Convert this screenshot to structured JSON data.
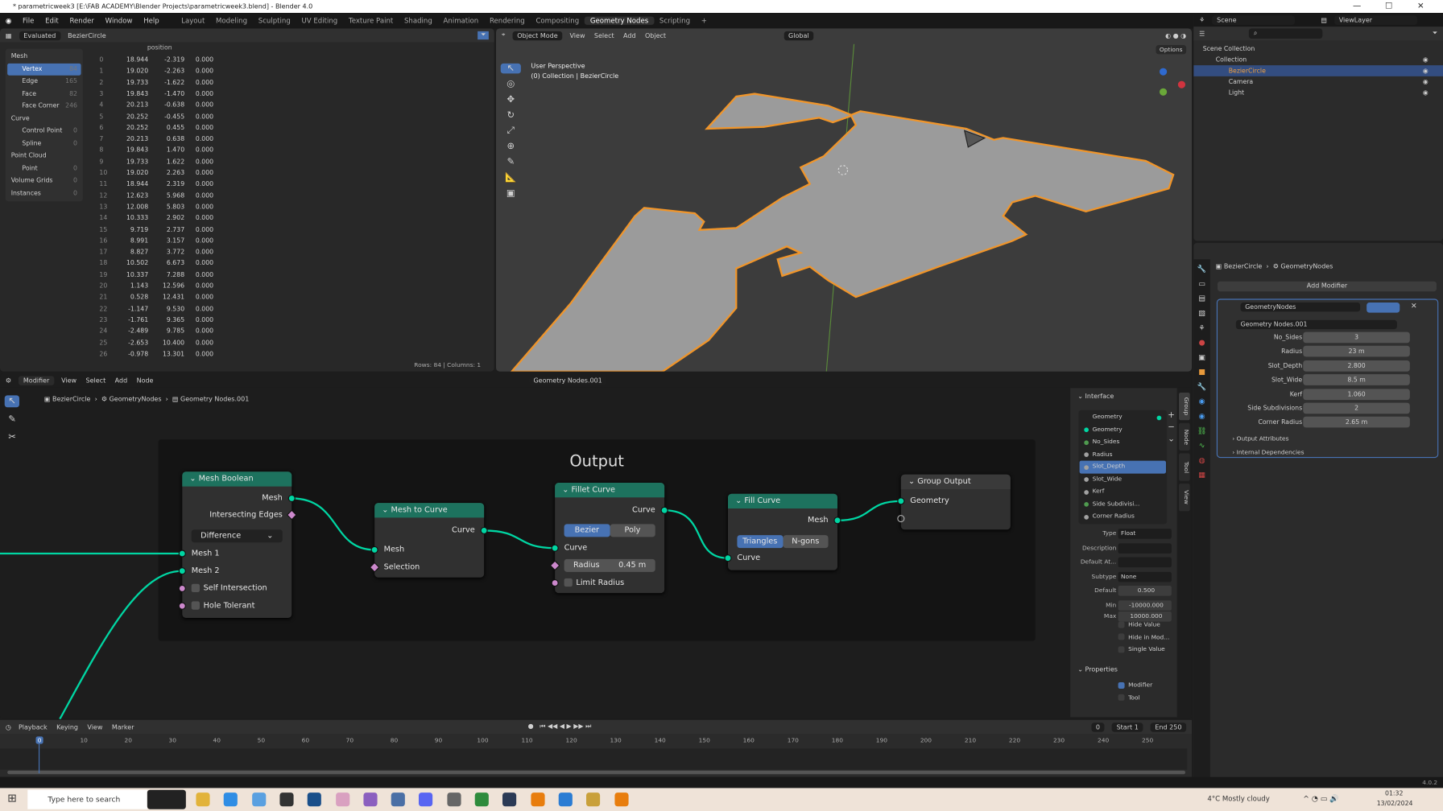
{
  "window": {
    "title": "* parametricweek3 [E:\\FAB ACADEMY\\Blender Projects\\parametricweek3.blend] - Blender 4.0",
    "minimize": "—",
    "maximize": "☐",
    "close": "✕"
  },
  "menu": [
    "File",
    "Edit",
    "Render",
    "Window",
    "Help"
  ],
  "workspaces": [
    "Layout",
    "Modeling",
    "Sculpting",
    "UV Editing",
    "Texture Paint",
    "Shading",
    "Animation",
    "Rendering",
    "Compositing",
    "Geometry Nodes",
    "Scripting",
    "+"
  ],
  "active_workspace": "Geometry Nodes",
  "spreadsheet": {
    "mode": "Evaluated",
    "object": "BezierCircle",
    "column": "position",
    "domains": [
      {
        "label": "Mesh",
        "count": "",
        "level": 0
      },
      {
        "label": "Vertex",
        "count": "84",
        "level": 1,
        "selected": true
      },
      {
        "label": "Edge",
        "count": "165",
        "level": 1
      },
      {
        "label": "Face",
        "count": "82",
        "level": 1
      },
      {
        "label": "Face Corner",
        "count": "246",
        "level": 1
      },
      {
        "label": "Curve",
        "count": "",
        "level": 0
      },
      {
        "label": "Control Point",
        "count": "0",
        "level": 1
      },
      {
        "label": "Spline",
        "count": "0",
        "level": 1
      },
      {
        "label": "Point Cloud",
        "count": "",
        "level": 0
      },
      {
        "label": "Point",
        "count": "0",
        "level": 1
      },
      {
        "label": "Volume Grids",
        "count": "0",
        "level": 0
      },
      {
        "label": "Instances",
        "count": "0",
        "level": 0
      }
    ],
    "rows": [
      [
        "0",
        "18.944",
        "-2.319",
        "0.000"
      ],
      [
        "1",
        "19.020",
        "-2.263",
        "0.000"
      ],
      [
        "2",
        "19.733",
        "-1.622",
        "0.000"
      ],
      [
        "3",
        "19.843",
        "-1.470",
        "0.000"
      ],
      [
        "4",
        "20.213",
        "-0.638",
        "0.000"
      ],
      [
        "5",
        "20.252",
        "-0.455",
        "0.000"
      ],
      [
        "6",
        "20.252",
        "0.455",
        "0.000"
      ],
      [
        "7",
        "20.213",
        "0.638",
        "0.000"
      ],
      [
        "8",
        "19.843",
        "1.470",
        "0.000"
      ],
      [
        "9",
        "19.733",
        "1.622",
        "0.000"
      ],
      [
        "10",
        "19.020",
        "2.263",
        "0.000"
      ],
      [
        "11",
        "18.944",
        "2.319",
        "0.000"
      ],
      [
        "12",
        "12.623",
        "5.968",
        "0.000"
      ],
      [
        "13",
        "12.008",
        "5.803",
        "0.000"
      ],
      [
        "14",
        "10.333",
        "2.902",
        "0.000"
      ],
      [
        "15",
        "9.719",
        "2.737",
        "0.000"
      ],
      [
        "16",
        "8.991",
        "3.157",
        "0.000"
      ],
      [
        "17",
        "8.827",
        "3.772",
        "0.000"
      ],
      [
        "18",
        "10.502",
        "6.673",
        "0.000"
      ],
      [
        "19",
        "10.337",
        "7.288",
        "0.000"
      ],
      [
        "20",
        "1.143",
        "12.596",
        "0.000"
      ],
      [
        "21",
        "0.528",
        "12.431",
        "0.000"
      ],
      [
        "22",
        "-1.147",
        "9.530",
        "0.000"
      ],
      [
        "23",
        "-1.761",
        "9.365",
        "0.000"
      ],
      [
        "24",
        "-2.489",
        "9.785",
        "0.000"
      ],
      [
        "25",
        "-2.653",
        "10.400",
        "0.000"
      ],
      [
        "26",
        "-0.978",
        "13.301",
        "0.000"
      ]
    ],
    "footer": "Rows: 84  |  Columns: 1"
  },
  "viewport": {
    "mode": "Object Mode",
    "menus": [
      "View",
      "Select",
      "Add",
      "Object"
    ],
    "orientation": "Global",
    "options": "Options",
    "title": "User Perspective",
    "subtitle": "(0) Collection | BezierCircle",
    "shape_fill": "#9b9b9b",
    "outline": "#f0952a"
  },
  "outliner": {
    "scene": "Scene",
    "view_layer": "ViewLayer",
    "items": [
      {
        "label": "Scene Collection",
        "level": 0
      },
      {
        "label": "Collection",
        "level": 1
      },
      {
        "label": "BezierCircle",
        "level": 2,
        "selected": true
      },
      {
        "label": "Camera",
        "level": 2
      },
      {
        "label": "Light",
        "level": 2
      }
    ]
  },
  "properties": {
    "breadcrumb": [
      "BezierCircle",
      "GeometryNodes"
    ],
    "add_modifier": "Add Modifier",
    "modifier_name": "GeometryNodes",
    "node_group": "Geometry Nodes.001",
    "inputs": [
      {
        "label": "No_Sides",
        "value": "3"
      },
      {
        "label": "Radius",
        "value": "23 m"
      },
      {
        "label": "Slot_Depth",
        "value": "2.800"
      },
      {
        "label": "Slot_Wide",
        "value": "8.5 m"
      },
      {
        "label": "Kerf",
        "value": "1.060"
      },
      {
        "label": "Side Subdivisions",
        "value": "2"
      },
      {
        "label": "Corner Radius",
        "value": "2.65 m"
      }
    ],
    "sections": [
      "Output Attributes",
      "Internal Dependencies"
    ]
  },
  "node_editor": {
    "type": "Modifier",
    "menus": [
      "View",
      "Select",
      "Add",
      "Node"
    ],
    "node_group": "Geometry Nodes.001",
    "breadcrumb": [
      "BezierCircle",
      "GeometryNodes",
      "Geometry Nodes.001"
    ],
    "frame_label": "Output",
    "nodes": {
      "mesh_boolean": {
        "title": "Mesh Boolean",
        "out": "Mesh",
        "intersecting": "Intersecting Edges",
        "mode": "Difference",
        "mesh1": "Mesh 1",
        "mesh2": "Mesh 2",
        "self": "Self Intersection",
        "hole": "Hole Tolerant"
      },
      "mesh_to_curve": {
        "title": "Mesh to Curve",
        "out": "Curve",
        "mesh": "Mesh",
        "selection": "Selection"
      },
      "fillet_curve": {
        "title": "Fillet Curve",
        "out": "Curve",
        "bezier": "Bezier",
        "poly": "Poly",
        "curve": "Curve",
        "radius_label": "Radius",
        "radius": "0.45 m",
        "limit": "Limit Radius"
      },
      "fill_curve": {
        "title": "Fill Curve",
        "out": "Mesh",
        "triangles": "Triangles",
        "ngons": "N-gons",
        "curve": "Curve"
      },
      "group_output": {
        "title": "Group Output",
        "geometry": "Geometry"
      }
    },
    "sidebar": {
      "interface_title": "Interface",
      "sockets": [
        {
          "label": "Geometry",
          "color": "#00d6a3",
          "out": true
        },
        {
          "label": "Geometry",
          "color": "#00d6a3"
        },
        {
          "label": "No_Sides",
          "color": "#4f9a4f"
        },
        {
          "label": "Radius",
          "color": "#a1a1a1"
        },
        {
          "label": "Slot_Depth",
          "color": "#a1a1a1",
          "selected": true
        },
        {
          "label": "Slot_Wide",
          "color": "#a1a1a1"
        },
        {
          "label": "Kerf",
          "color": "#a1a1a1"
        },
        {
          "label": "Side Subdivisi...",
          "color": "#4f9a4f"
        },
        {
          "label": "Corner Radius",
          "color": "#a1a1a1"
        }
      ],
      "fields": [
        {
          "label": "Type",
          "value": "Float"
        },
        {
          "label": "Description",
          "value": ""
        },
        {
          "label": "Default At...",
          "value": ""
        },
        {
          "label": "Subtype",
          "value": "None"
        },
        {
          "label": "Default",
          "value": "0.500"
        },
        {
          "label": "Min",
          "value": "-10000.000"
        },
        {
          "label": "Max",
          "value": "10000.000"
        }
      ],
      "checks": [
        "Hide Value",
        "Hide in Mod...",
        "Single Value"
      ],
      "properties_title": "Properties",
      "prop_checks": [
        {
          "label": "Modifier",
          "checked": true
        },
        {
          "label": "Tool",
          "checked": false
        }
      ],
      "tabs": [
        "Group",
        "Node",
        "Tool",
        "View"
      ]
    }
  },
  "timeline": {
    "menus": [
      "Playback",
      "Keying",
      "View",
      "Marker"
    ],
    "current": "0",
    "start_label": "Start",
    "start": "1",
    "end_label": "End",
    "end": "250",
    "ticks": [
      "0",
      "10",
      "20",
      "30",
      "40",
      "50",
      "60",
      "70",
      "80",
      "90",
      "100",
      "110",
      "120",
      "130",
      "140",
      "150",
      "160",
      "170",
      "180",
      "190",
      "200",
      "210",
      "220",
      "230",
      "240",
      "250"
    ]
  },
  "status": {
    "version": "4.0.2"
  },
  "taskbar": {
    "search": "Type here to search",
    "weather": "4°C  Mostly cloudy",
    "time": "01:32",
    "date": "13/02/2024"
  }
}
